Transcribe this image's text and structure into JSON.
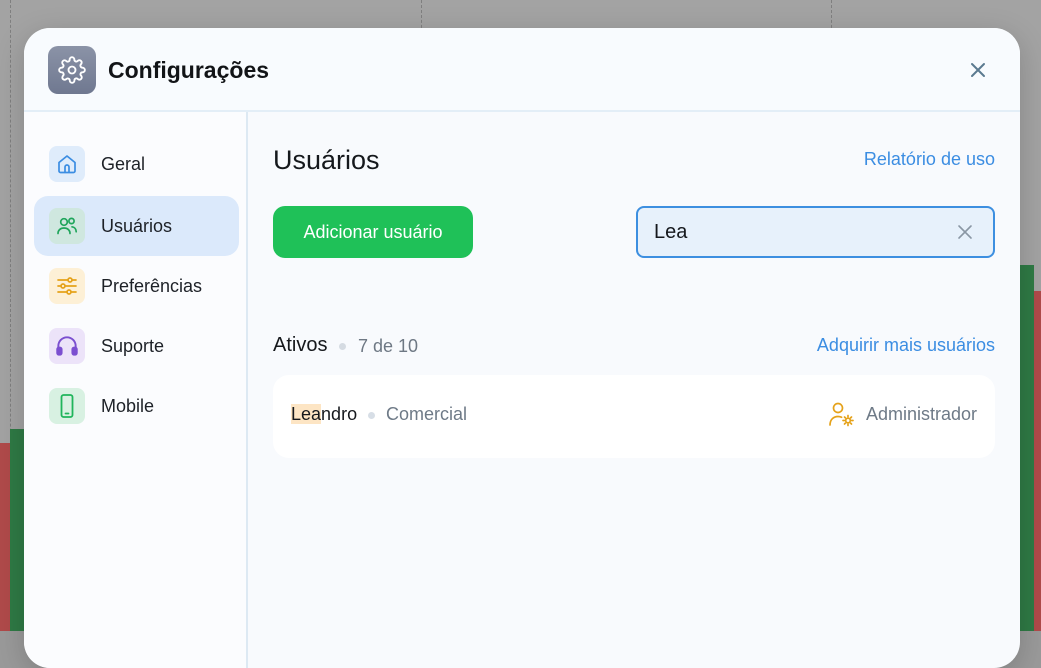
{
  "header": {
    "title": "Configurações",
    "app_icon": "gear-icon",
    "close_icon": "close-icon"
  },
  "sidebar": {
    "items": [
      {
        "label": "Geral",
        "icon": "home-icon",
        "color": "#3b8de2",
        "active": false
      },
      {
        "label": "Usuários",
        "icon": "users-icon",
        "color": "#1fa55b",
        "active": true
      },
      {
        "label": "Preferências",
        "icon": "sliders-icon",
        "color": "#e5a21a",
        "active": false
      },
      {
        "label": "Suporte",
        "icon": "headset-icon",
        "color": "#7b4fd0",
        "active": false
      },
      {
        "label": "Mobile",
        "icon": "smartphone-icon",
        "color": "#1fb55b",
        "active": false
      }
    ]
  },
  "main": {
    "title": "Usuários",
    "report_link": "Relatório de uso",
    "add_button": "Adicionar usuário",
    "search": {
      "value": "Lea",
      "placeholder": ""
    },
    "section": {
      "title": "Ativos",
      "count": "7 de 10",
      "more_link": "Adquirir mais usuários"
    },
    "users": [
      {
        "name_highlight": "Lea",
        "name_rest": "ndro",
        "department": "Comercial",
        "role": "Administrador",
        "role_icon": "user-gear-icon"
      }
    ]
  },
  "colors": {
    "accent": "#3b8de2",
    "primary_button": "#1fc158",
    "highlight": "#fde5c4",
    "role_icon": "#e5a21a"
  }
}
